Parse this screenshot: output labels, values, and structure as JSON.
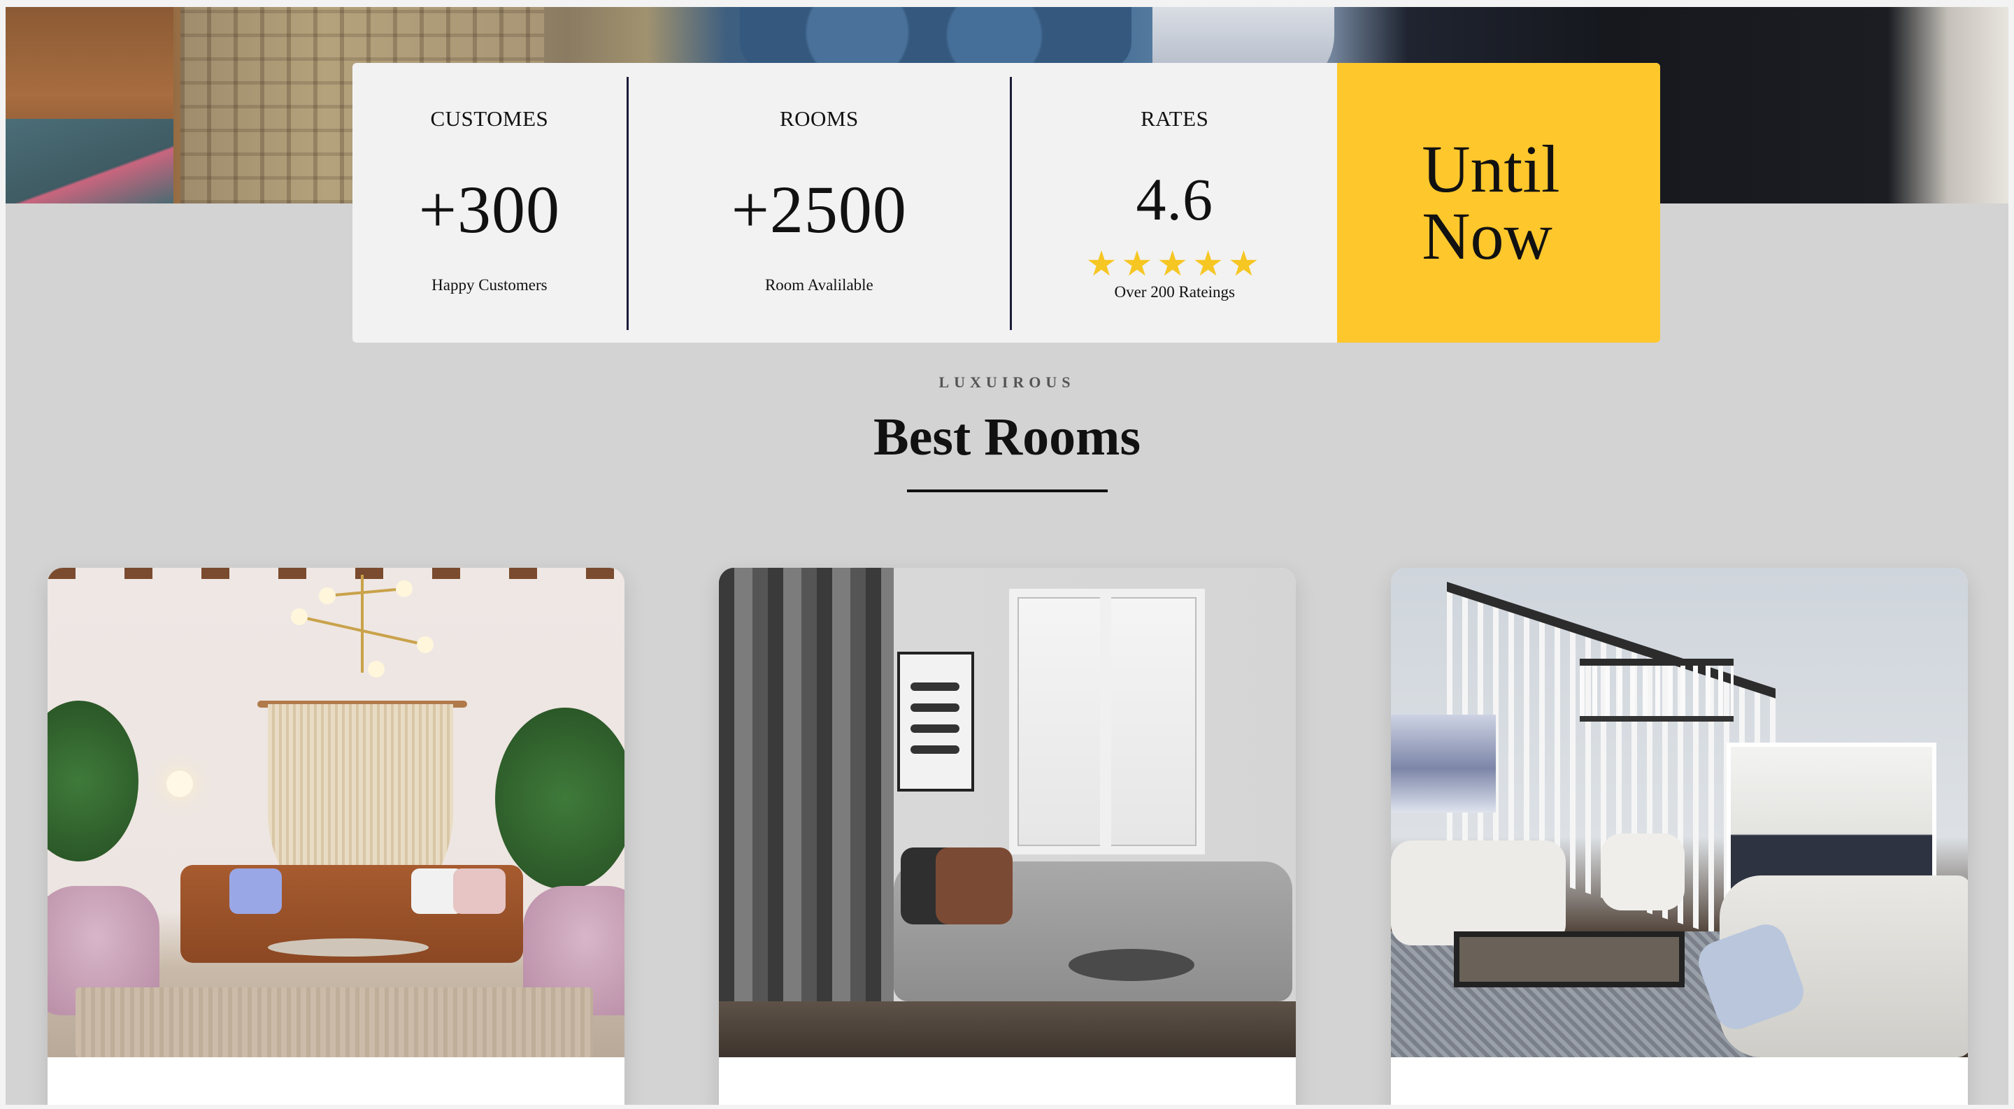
{
  "stats": {
    "customers": {
      "label": "CUSTOMES",
      "value": "+300",
      "sub": "Happy Customers"
    },
    "rooms": {
      "label": "ROOMS",
      "value": "+2500",
      "sub": "Room Avalilable"
    },
    "rates": {
      "label": "RATES",
      "value": "4.6",
      "stars": "★★★★★",
      "rating": 5,
      "sub": "Over 200 Rateings"
    },
    "cta": {
      "line1": "Until",
      "line2": "Now"
    }
  },
  "section": {
    "kicker": "LUXUIROUS",
    "title": "Best Rooms"
  },
  "colors": {
    "accent": "#fec72c",
    "star": "#f6c623",
    "page_bg": "#d3d3d3",
    "card_bg": "#f2f2f2"
  }
}
